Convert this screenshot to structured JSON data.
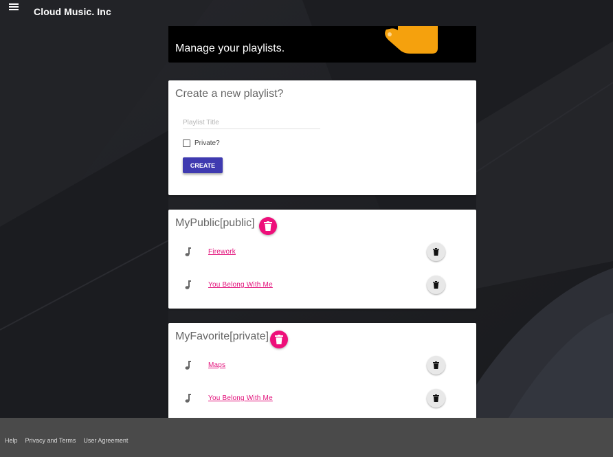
{
  "header": {
    "brand": "Cloud Music. Inc",
    "menu_icon": "hamburger-menu-icon"
  },
  "banner": {
    "text": "Manage your playlists."
  },
  "create_playlist": {
    "heading": "Create a new playlist?",
    "title_value": "",
    "title_placeholder": "Playlist Title",
    "private_label": "Private?",
    "private_checked": false,
    "create_label": "CREATE"
  },
  "playlists": [
    {
      "title": "MyPublic[public]",
      "songs": [
        {
          "title": "Firework"
        },
        {
          "title": "You Belong With Me"
        }
      ]
    },
    {
      "title": "MyFavorite[private]",
      "songs": [
        {
          "title": "Maps"
        },
        {
          "title": "You Belong With Me"
        }
      ]
    }
  ],
  "footer": {
    "links": [
      "Help",
      "Privacy and Terms",
      "User Agreement"
    ]
  },
  "colors": {
    "accent_pink": "#ee0f7a",
    "button_primary": "#3f3ab0",
    "link_color": "#e2107a",
    "footer_bg": "#4a4a4a",
    "page_bg": "#1f2024",
    "banner_graphic": "#f5a10d"
  }
}
